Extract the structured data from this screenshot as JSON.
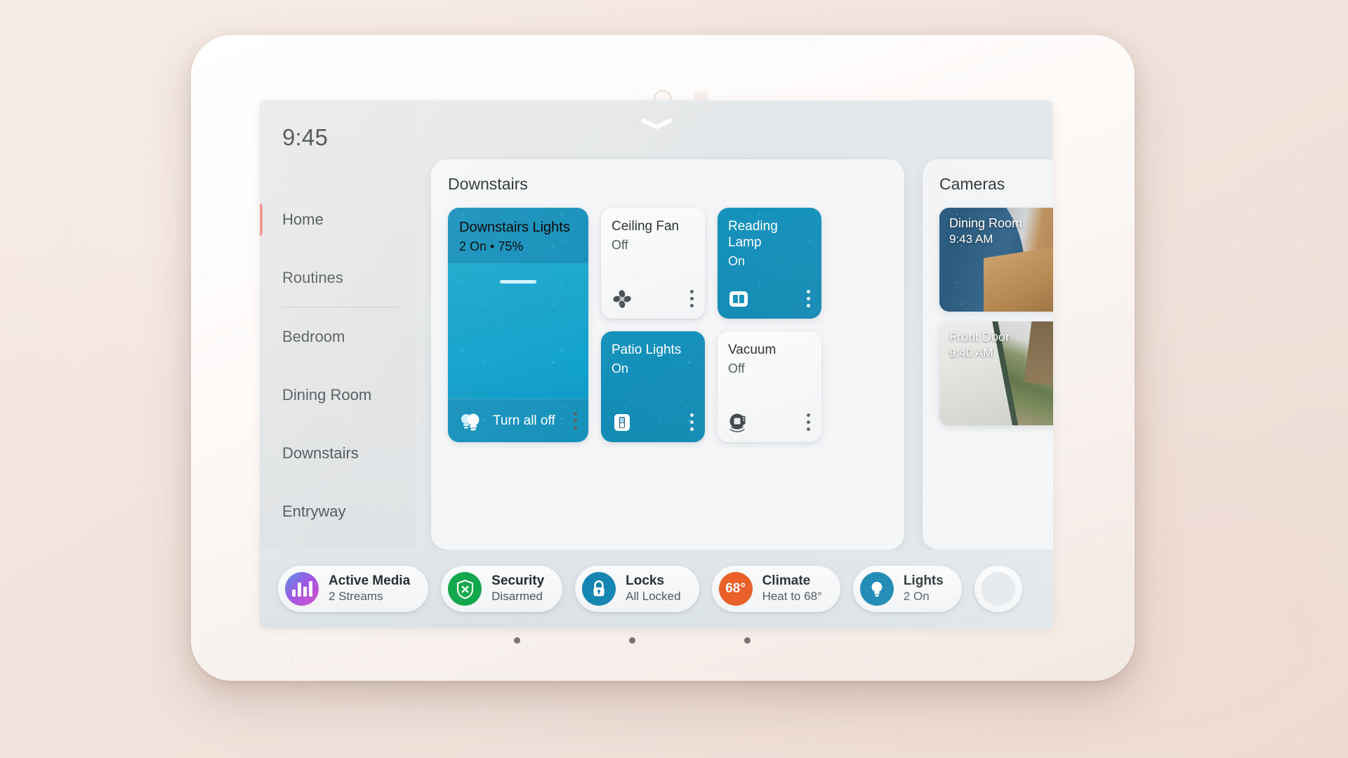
{
  "device": {
    "name": "smart-home-hub-display"
  },
  "screen": {
    "pull_handle_icon": "chevron-down-icon",
    "clock": "9:45"
  },
  "sidebar": {
    "items": [
      {
        "label": "Home",
        "active": true
      },
      {
        "label": "Routines",
        "active": false
      },
      {
        "label": "Bedroom",
        "active": false
      },
      {
        "label": "Dining Room",
        "active": false
      },
      {
        "label": "Downstairs",
        "active": false
      },
      {
        "label": "Entryway",
        "active": false
      }
    ]
  },
  "downstairs_panel": {
    "title": "Downstairs",
    "lights_group": {
      "name": "Downstairs Lights",
      "state": "2 On • 75%",
      "brightness_percent": 75,
      "on": true,
      "action_label": "Turn all off",
      "action_icon": "light-bulbs-icon",
      "menu_icon": "kebab-menu-icon"
    },
    "devices": [
      {
        "name": "Ceiling Fan",
        "state": "Off",
        "on": false,
        "icon": "fan-icon",
        "menu_icon": "kebab-menu-icon"
      },
      {
        "name": "Reading Lamp",
        "state": "On",
        "on": true,
        "icon": "double-rocker-switch-icon",
        "menu_icon": "kebab-menu-icon"
      },
      {
        "name": "Patio Lights",
        "state": "On",
        "on": true,
        "icon": "toggle-switch-icon",
        "menu_icon": "kebab-menu-icon"
      },
      {
        "name": "Vacuum",
        "state": "Off",
        "on": false,
        "icon": "robot-vacuum-icon",
        "menu_icon": "kebab-menu-icon"
      }
    ]
  },
  "cameras_panel": {
    "title": "Cameras",
    "cameras": [
      {
        "name": "Dining Room",
        "time": "9:43 AM"
      },
      {
        "name": "Front Door",
        "time": "9:40 AM"
      }
    ]
  },
  "statusbar": {
    "pills": [
      {
        "title": "Active Media",
        "sub": "2 Streams",
        "icon": "media-equalizer-icon",
        "color": "#b34de0"
      },
      {
        "title": "Security",
        "sub": "Disarmed",
        "icon": "shield-x-icon",
        "color": "#11a74a"
      },
      {
        "title": "Locks",
        "sub": "All Locked",
        "icon": "lock-icon",
        "color": "#1183b0"
      },
      {
        "title": "Climate",
        "sub": "Heat to 68°",
        "icon": "temperature-badge-icon",
        "color": "#e8581f",
        "badge": "68°"
      },
      {
        "title": "Lights",
        "sub": "2 On",
        "icon": "light-bulb-icon",
        "color": "#1183b0"
      }
    ]
  },
  "colors": {
    "accent_on": "#1492bd",
    "slider_fill": "#16a3cb",
    "active_marker": "#f2837e",
    "security_green": "#11a74a",
    "climate_orange": "#e8581f",
    "lock_blue": "#1183b0"
  }
}
